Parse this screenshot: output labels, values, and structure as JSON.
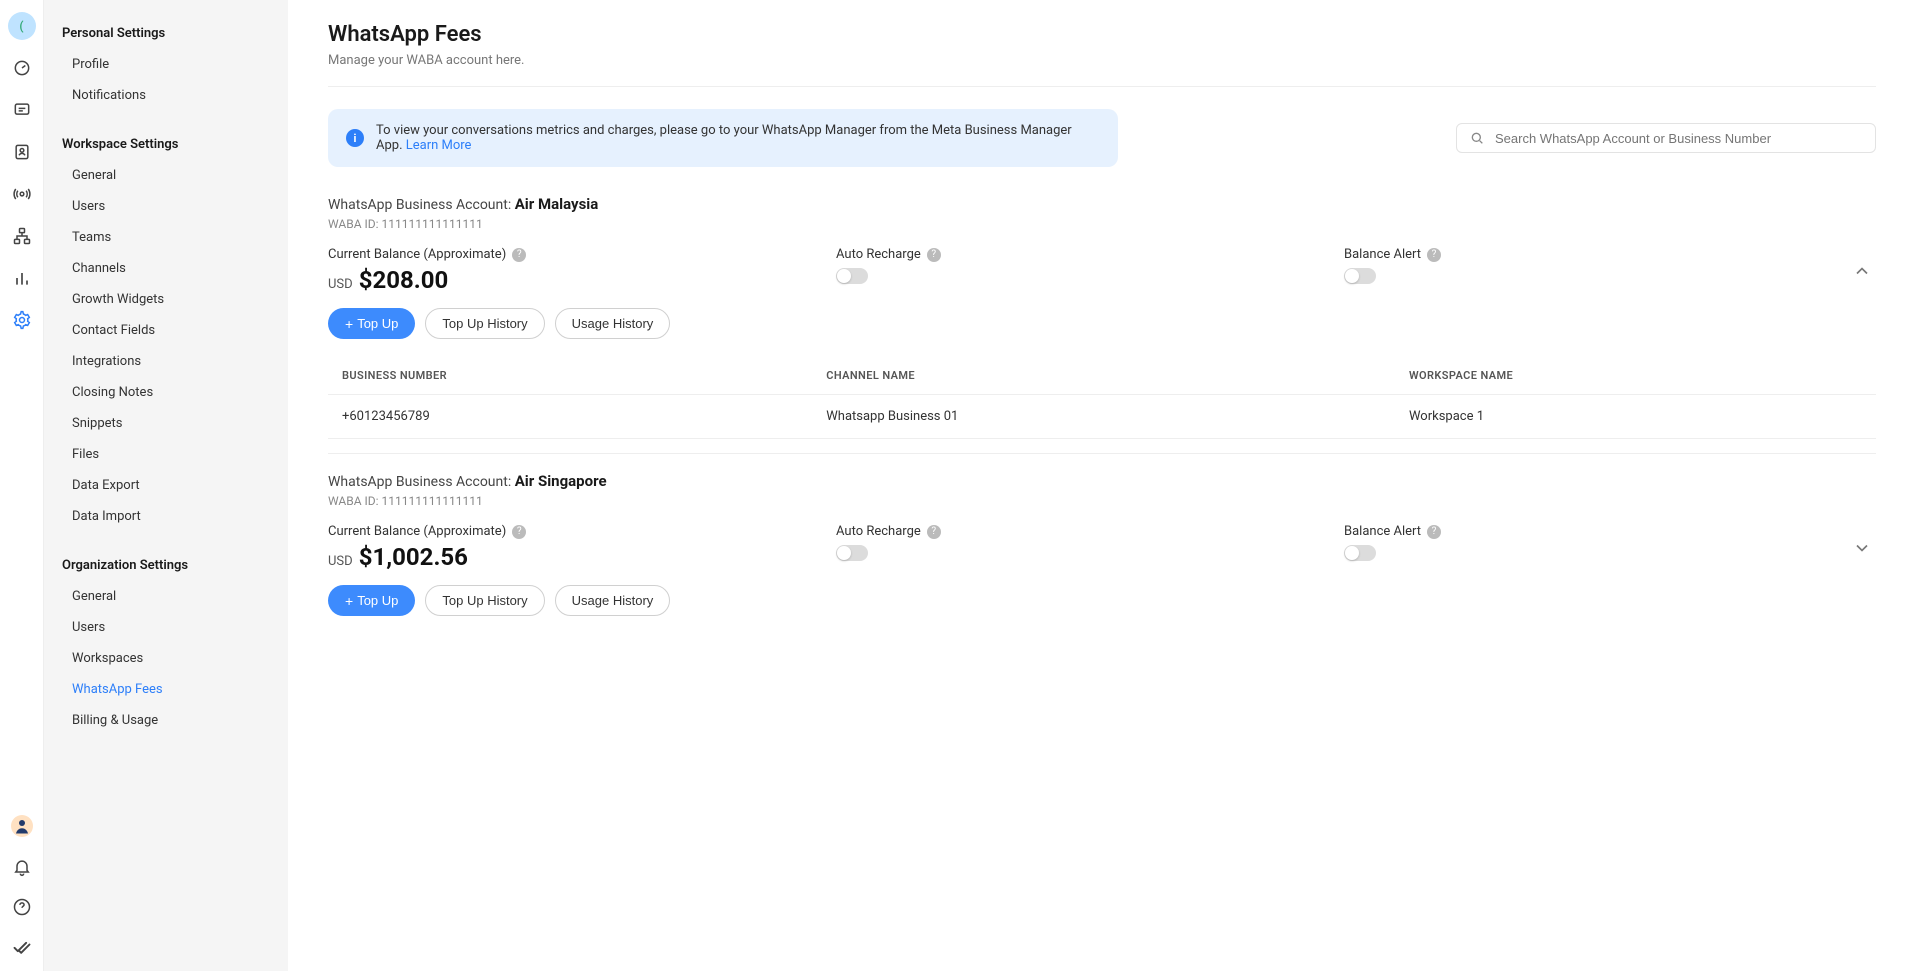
{
  "rail": {
    "avatar_initial": "("
  },
  "sidebar": {
    "section1_title": "Personal Settings",
    "section1_items": [
      "Profile",
      "Notifications"
    ],
    "section2_title": "Workspace Settings",
    "section2_items": [
      "General",
      "Users",
      "Teams",
      "Channels",
      "Growth Widgets",
      "Contact Fields",
      "Integrations",
      "Closing Notes",
      "Snippets",
      "Files",
      "Data Export",
      "Data Import"
    ],
    "section3_title": "Organization Settings",
    "section3_items": [
      "General",
      "Users",
      "Workspaces",
      "WhatsApp Fees",
      "Billing & Usage"
    ],
    "section3_active_index": 3
  },
  "page": {
    "title": "WhatsApp Fees",
    "subtitle": "Manage your WABA account here.",
    "banner_text": "To view your conversations metrics and charges, please go to your WhatsApp Manager from the Meta Business Manager App. ",
    "banner_link": "Learn More",
    "search_placeholder": "Search WhatsApp Account or Business Number"
  },
  "labels": {
    "waba_prefix": "WhatsApp Business Account: ",
    "waba_id_prefix": "WABA ID: ",
    "current_balance": "Current Balance (Approximate)",
    "auto_recharge": "Auto Recharge",
    "balance_alert": "Balance Alert",
    "currency": "USD",
    "top_up": "Top Up",
    "top_up_history": "Top Up History",
    "usage_history": "Usage History",
    "col_business_number": "BUSINESS NUMBER",
    "col_channel_name": "CHANNEL NAME",
    "col_workspace_name": "WORKSPACE NAME"
  },
  "accounts": [
    {
      "name": "Air Malaysia",
      "waba_id": "111111111111111",
      "balance": "$208.00",
      "expanded": true,
      "rows": [
        {
          "number": "+60123456789",
          "channel": "Whatsapp Business 01",
          "workspace": "Workspace 1"
        }
      ]
    },
    {
      "name": "Air Singapore",
      "waba_id": "111111111111111",
      "balance": "$1,002.56",
      "expanded": false,
      "rows": []
    }
  ]
}
